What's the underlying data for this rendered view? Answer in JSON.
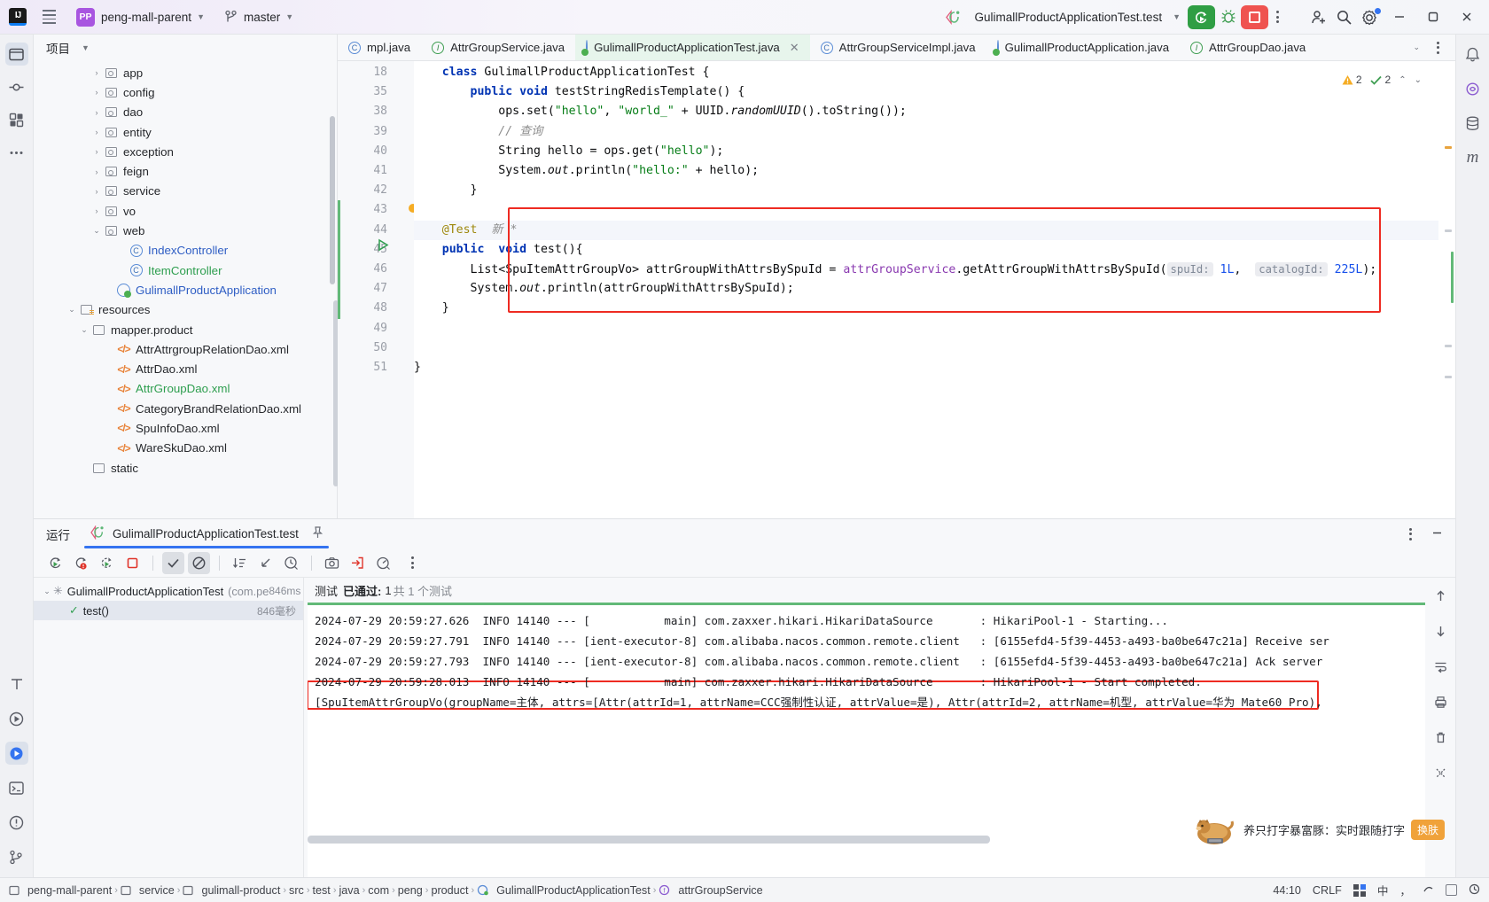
{
  "titlebar": {
    "logo": "IJ",
    "project": "peng-mall-parent",
    "project_badge": "PP",
    "branch": "master",
    "run_config": "GulimallProductApplicationTest.test",
    "icons": {
      "menu": "hamburger-icon",
      "vcs": "branch-icon",
      "run": "run-icon",
      "debug": "debug-icon",
      "stop": "stop-icon",
      "more": "more-icon",
      "share": "add-user-icon",
      "search": "search-icon",
      "settings": "gear-icon",
      "minimize": "minimize-icon",
      "maximize": "maximize-icon",
      "close": "close-icon"
    }
  },
  "project_panel": {
    "title": "项目",
    "tree": [
      {
        "label": "app",
        "indent": 4,
        "arrow": "right",
        "icon": "folder-src",
        "color": "dark"
      },
      {
        "label": "config",
        "indent": 4,
        "arrow": "right",
        "icon": "folder-src",
        "color": "dark"
      },
      {
        "label": "dao",
        "indent": 4,
        "arrow": "right",
        "icon": "folder-src",
        "color": "dark"
      },
      {
        "label": "entity",
        "indent": 4,
        "arrow": "right",
        "icon": "folder-src",
        "color": "dark"
      },
      {
        "label": "exception",
        "indent": 4,
        "arrow": "right",
        "icon": "folder-src",
        "color": "dark"
      },
      {
        "label": "feign",
        "indent": 4,
        "arrow": "right",
        "icon": "folder-src",
        "color": "dark"
      },
      {
        "label": "service",
        "indent": 4,
        "arrow": "right",
        "icon": "folder-src",
        "color": "dark"
      },
      {
        "label": "vo",
        "indent": 4,
        "arrow": "right",
        "icon": "folder-src",
        "color": "dark"
      },
      {
        "label": "web",
        "indent": 4,
        "arrow": "down",
        "icon": "folder-src",
        "color": "dark"
      },
      {
        "label": "IndexController",
        "indent": 6,
        "arrow": "",
        "icon": "class",
        "color": "blue"
      },
      {
        "label": "ItemController",
        "indent": 6,
        "arrow": "",
        "icon": "class",
        "color": "green"
      },
      {
        "label": "GulimallProductApplication",
        "indent": 5,
        "arrow": "",
        "icon": "spring",
        "color": "blue"
      },
      {
        "label": "resources",
        "indent": 2,
        "arrow": "down",
        "icon": "folder-res",
        "color": "dark"
      },
      {
        "label": "mapper.product",
        "indent": 3,
        "arrow": "down",
        "icon": "folder",
        "color": "dark"
      },
      {
        "label": "AttrAttrgroupRelationDao.xml",
        "indent": 5,
        "arrow": "",
        "icon": "xml",
        "color": "dark"
      },
      {
        "label": "AttrDao.xml",
        "indent": 5,
        "arrow": "",
        "icon": "xml",
        "color": "dark"
      },
      {
        "label": "AttrGroupDao.xml",
        "indent": 5,
        "arrow": "",
        "icon": "xml",
        "color": "green"
      },
      {
        "label": "CategoryBrandRelationDao.xml",
        "indent": 5,
        "arrow": "",
        "icon": "xml",
        "color": "dark"
      },
      {
        "label": "SpuInfoDao.xml",
        "indent": 5,
        "arrow": "",
        "icon": "xml",
        "color": "dark"
      },
      {
        "label": "WareSkuDao.xml",
        "indent": 5,
        "arrow": "",
        "icon": "xml",
        "color": "dark"
      },
      {
        "label": "static",
        "indent": 3,
        "arrow": "",
        "icon": "folder",
        "color": "dark"
      }
    ]
  },
  "editor": {
    "tabs": [
      {
        "label": "mpl.java",
        "icon": "class",
        "active": false,
        "closable": false
      },
      {
        "label": "AttrGroupService.java",
        "icon": "interface",
        "active": false,
        "closable": false
      },
      {
        "label": "GulimallProductApplicationTest.java",
        "icon": "spring-test",
        "active": true,
        "closable": true
      },
      {
        "label": "AttrGroupServiceImpl.java",
        "icon": "class",
        "active": false,
        "closable": false
      },
      {
        "label": "GulimallProductApplication.java",
        "icon": "spring",
        "active": false,
        "closable": false
      },
      {
        "label": "AttrGroupDao.java",
        "icon": "interface",
        "active": false,
        "closable": false
      }
    ],
    "inspection": {
      "warnings": "2",
      "checks": "2"
    },
    "line_numbers": [
      "18",
      "35",
      "38",
      "39",
      "40",
      "41",
      "42",
      "43",
      "44",
      "45",
      "46",
      "47",
      "48",
      "49",
      "50",
      "51"
    ],
    "code_lines": [
      {
        "n": 0,
        "html": "    <span class=\"k\">class</span> GulimallProductApplicationTest {"
      },
      {
        "n": 1,
        "html": "        <span class=\"k\">public</span> <span class=\"k\">void</span> testStringRedisTemplate() {"
      },
      {
        "n": 2,
        "html": "            ops.set(<span class=\"s\">\"hello\"</span>, <span class=\"s\">\"world_\"</span> + UUID.<span class=\"it\">randomUUID</span>().toString());"
      },
      {
        "n": 3,
        "html": "            <span class=\"c\">// 查询</span>"
      },
      {
        "n": 4,
        "html": "            String hello = ops.get(<span class=\"s\">\"hello\"</span>);"
      },
      {
        "n": 5,
        "html": "            System.<span class=\"it\">out</span>.println(<span class=\"s\">\"hello:\"</span> + hello);"
      },
      {
        "n": 6,
        "html": "        }"
      },
      {
        "n": 7,
        "html": ""
      },
      {
        "n": 8,
        "html": "    <span class=\"ann\">@Test</span>  <span class=\"c\">新 *</span>"
      },
      {
        "n": 9,
        "html": "    <span class=\"k\">public</span>  <span class=\"k\">void</span> test(){"
      },
      {
        "n": 10,
        "html": "        List&lt;SpuItemAttrGroupVo&gt; attrGroupWithAttrsBySpuId = <span class=\"m\">attrGroupService</span>.getAttrGroupWithAttrsBySpuId(<span class=\"hint\">spuId:</span> <span class=\"n\">1L</span>,  <span class=\"hint\">catalogId:</span> <span class=\"n\">225L</span>);"
      },
      {
        "n": 11,
        "html": "        System.<span class=\"it\">out</span>.println(attrGroupWithAttrsBySpuId);"
      },
      {
        "n": 12,
        "html": "    }"
      },
      {
        "n": 13,
        "html": ""
      },
      {
        "n": 14,
        "html": ""
      },
      {
        "n": 15,
        "html": "}"
      }
    ]
  },
  "run_panel": {
    "label": "运行",
    "tab": "GulimallProductApplicationTest.test",
    "toolbar_icons": [
      "rerun-icon",
      "rerun-failed-icon",
      "rerun-coverage-icon",
      "stop-icon",
      "show-passed-icon",
      "hide-ignored-icon",
      "sort-icon",
      "expand-icon",
      "history-icon",
      "screenshot-icon",
      "export-icon",
      "profile-icon",
      "more-icon"
    ],
    "test_tree": [
      {
        "label": "GulimallProductApplicationTest",
        "sub": "(com.pe",
        "time": "846ms",
        "indent": 0,
        "icon": "running"
      },
      {
        "label": "test()",
        "sub": "",
        "time": "846毫秒",
        "indent": 1,
        "icon": "passed"
      }
    ],
    "status": {
      "prefix": "测试",
      "passed_label": "已通过:",
      "passed": "1",
      "total_label": "共 1 个测试"
    },
    "console_lines": [
      "2024-07-29 20:59:27.626  INFO 14140 --- [           main] com.zaxxer.hikari.HikariDataSource       : HikariPool-1 - Starting...",
      "2024-07-29 20:59:27.791  INFO 14140 --- [ient-executor-8] com.alibaba.nacos.common.remote.client   : [6155efd4-5f39-4453-a493-ba0be647c21a] Receive ser",
      "2024-07-29 20:59:27.793  INFO 14140 --- [ient-executor-8] com.alibaba.nacos.common.remote.client   : [6155efd4-5f39-4453-a493-ba0be647c21a] Ack server",
      "2024-07-29 20:59:28.013  INFO 14140 --- [           main] com.zaxxer.hikari.HikariDataSource       : HikariPool-1 - Start completed.",
      "[SpuItemAttrGroupVo(groupName=主体, attrs=[Attr(attrId=1, attrName=CCC强制性认证, attrValue=是), Attr(attrId=2, attrName=机型, attrValue=华为 Mate60 Pro),"
    ],
    "console_side_icons": [
      "scroll-up-icon",
      "scroll-down-icon",
      "wrap-icon",
      "print-icon",
      "trash-icon",
      "close-icon"
    ]
  },
  "promo": {
    "text": "养只打字暴富豚：实时跟随打字",
    "button": "换肤"
  },
  "statusbar": {
    "breadcrumbs": [
      {
        "label": "peng-mall-parent",
        "icon": "module"
      },
      {
        "label": "service",
        "icon": "module"
      },
      {
        "label": "gulimall-product",
        "icon": "module"
      },
      {
        "label": "src",
        "icon": ""
      },
      {
        "label": "test",
        "icon": ""
      },
      {
        "label": "java",
        "icon": ""
      },
      {
        "label": "com",
        "icon": ""
      },
      {
        "label": "peng",
        "icon": ""
      },
      {
        "label": "product",
        "icon": ""
      },
      {
        "label": "GulimallProductApplicationTest",
        "icon": "spring-test"
      },
      {
        "label": "attrGroupService",
        "icon": "field"
      }
    ],
    "caret": "44:10",
    "line_sep": "CRLF",
    "ime": "中"
  },
  "colors": {
    "accent": "#3574f0",
    "run_green": "#2f9e44",
    "stop_red": "#ef5350",
    "highlight_red": "#ee2b22",
    "tab_active_bg": "#e7f5ec",
    "purple_badge": "#a855e0"
  }
}
